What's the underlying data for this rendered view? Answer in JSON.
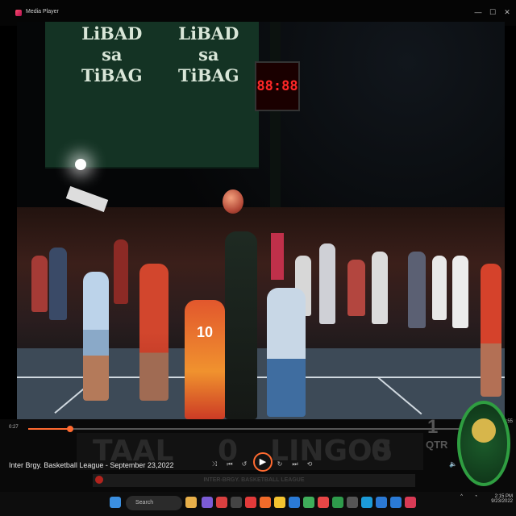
{
  "window": {
    "title": "Media Player",
    "minimize": "—",
    "maximize": "☐",
    "close": "✕"
  },
  "video": {
    "banner_left": "LiBAD\nsa\nTiBAG",
    "banner_right": "LiBAD\nsa\nTiBAG",
    "shot_clock": "88:88",
    "jersey_number": "10"
  },
  "player": {
    "time_elapsed": "0:27",
    "time_total": "0:55",
    "progress_fraction": 0.09,
    "caption": "Inter Brgy. Basketball League - September 23,2022",
    "scoreboard": {
      "team_left": "TAAL",
      "score_left": "0",
      "team_right": "LINGOS",
      "score_right": "0",
      "quarter": "1",
      "quarter_label": "QTR"
    },
    "ticker": "INTER-BRGY. BASKETBALL LEAGUE"
  },
  "taskbar": {
    "search_placeholder": "Search",
    "clock_time": "2:15 PM",
    "clock_date": "9/23/2022"
  },
  "colors": {
    "accent": "#ff6a30"
  }
}
